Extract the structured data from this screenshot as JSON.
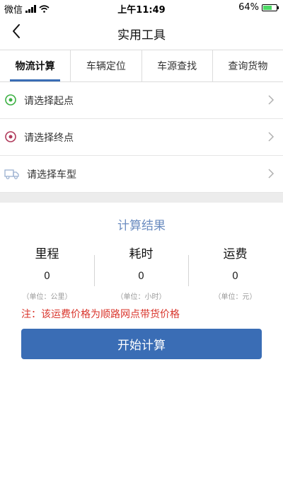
{
  "status_bar": {
    "carrier": "微信",
    "time": "上午11:49",
    "battery": "64%"
  },
  "nav": {
    "title": "实用工具"
  },
  "tabs": [
    {
      "label": "物流计算",
      "active": true
    },
    {
      "label": "车辆定位",
      "active": false
    },
    {
      "label": "车源查找",
      "active": false
    },
    {
      "label": "查询货物",
      "active": false
    }
  ],
  "form": {
    "origin_label": "请选择起点",
    "destination_label": "请选择终点",
    "vehicle_label": "请选择车型"
  },
  "result": {
    "title": "计算结果",
    "columns": [
      {
        "header": "里程",
        "value": "0",
        "unit": "（单位：公里）"
      },
      {
        "header": "耗时",
        "value": "0",
        "unit": "（单位：小时）"
      },
      {
        "header": "运费",
        "value": "0",
        "unit": "（单位：元）"
      }
    ]
  },
  "note": "注：该运费价格为顺路网点带货价格",
  "button": {
    "label": "开始计算"
  },
  "colors": {
    "accent": "#3a6db5",
    "result_title": "#6b8cc0",
    "note": "#d9342b",
    "origin": "#3cb043",
    "destination": "#b03a5b"
  }
}
